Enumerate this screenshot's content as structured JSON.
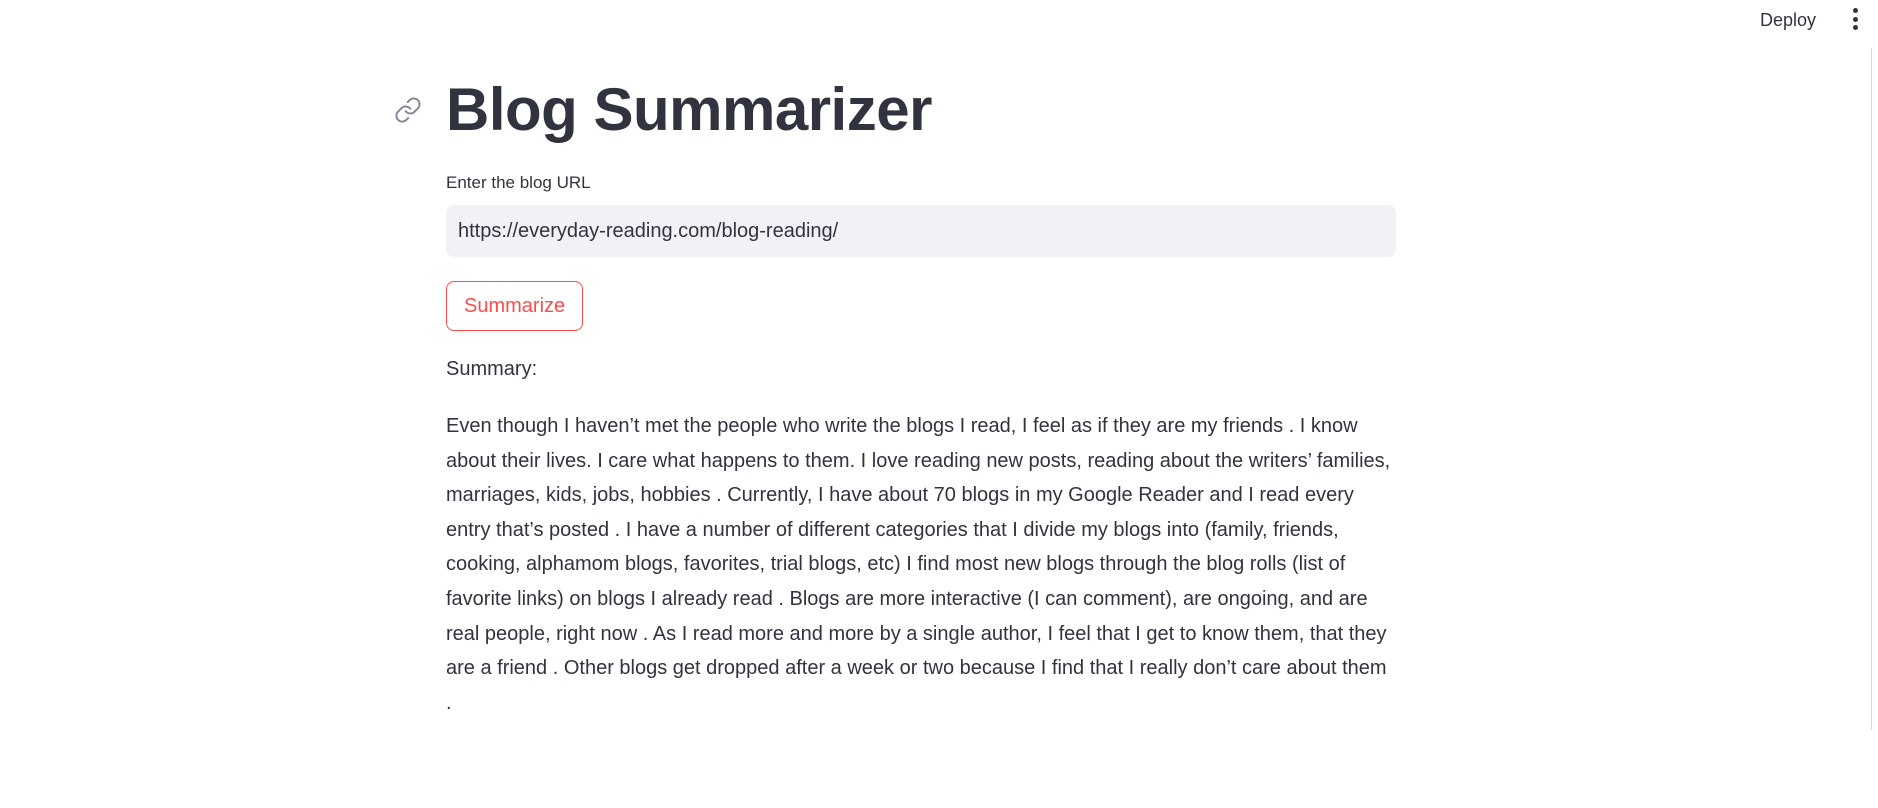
{
  "header": {
    "deploy_label": "Deploy",
    "menu_icon": "kebab-vertical-icon"
  },
  "main": {
    "title": "Blog Summarizer",
    "anchor_icon": "link-icon",
    "url_label": "Enter the blog URL",
    "url_value": "https://everyday-reading.com/blog-reading/",
    "summarize_label": "Summarize",
    "summary_heading": "Summary:",
    "summary_text": "Even though I haven’t met the people who write the blogs I read, I feel as if they are my friends . I know about their lives. I care what happens to them. I love reading new posts, reading about the writers’ families, marriages, kids, jobs, hobbies . Currently, I have about 70 blogs in my Google Reader and I read every entry that’s posted . I have a number of different categories that I divide my blogs into (family, friends, cooking, alphamom blogs, favorites, trial blogs, etc) I find most new blogs through the blog rolls (list of favorite links) on blogs I already read . Blogs are more interactive (I can comment), are ongoing, and are real people, right now . As I read more and more by a single author, I feel that I get to know them, that they are a friend . Other blogs get dropped after a week or two because I find that I really don’t care about them ."
  },
  "colors": {
    "accent": "#ff4b4b",
    "text": "#31333f",
    "input_bg": "#f0f2f6"
  }
}
